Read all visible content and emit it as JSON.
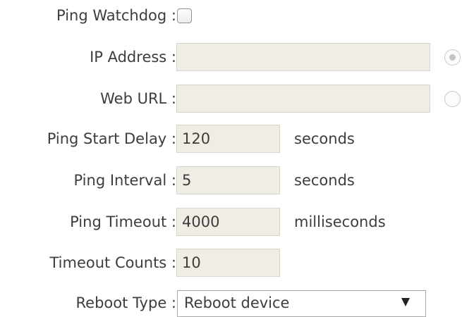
{
  "form": {
    "ping_watchdog": {
      "label": "Ping Watchdog :",
      "checked": false
    },
    "ip_address": {
      "label": "IP Address :",
      "value": "",
      "selected": true
    },
    "web_url": {
      "label": "Web URL :",
      "value": "",
      "selected": false
    },
    "ping_start_delay": {
      "label": "Ping Start Delay :",
      "value": "120",
      "unit": "seconds"
    },
    "ping_interval": {
      "label": "Ping Interval :",
      "value": "5",
      "unit": "seconds"
    },
    "ping_timeout": {
      "label": "Ping Timeout :",
      "value": "4000",
      "unit": "milliseconds"
    },
    "timeout_counts": {
      "label": "Timeout Counts :",
      "value": "10"
    },
    "reboot_type": {
      "label": "Reboot Type :",
      "selected": "Reboot device"
    }
  },
  "colors": {
    "field_background": "#efede4",
    "field_border": "#d7d5cd",
    "text": "#3d3d3d"
  }
}
